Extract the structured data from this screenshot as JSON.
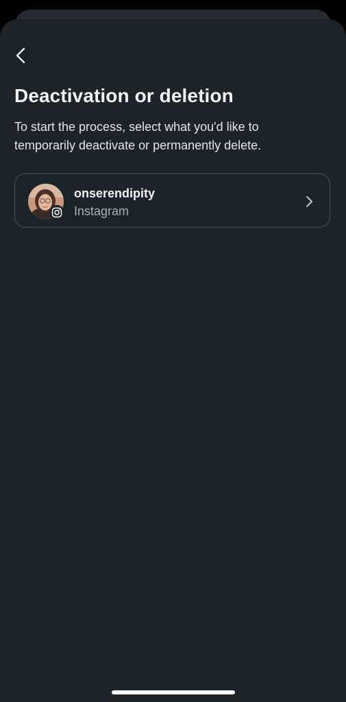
{
  "header": {
    "back_icon": "chevron-left-icon",
    "title": "Deactivation or deletion",
    "subtitle": "To start the process, select what you'd like to temporarily deactivate or permanently delete."
  },
  "accounts": [
    {
      "username": "onserendipity",
      "platform": "Instagram",
      "avatar_icon": "profile-photo",
      "badge_icon": "instagram-icon",
      "chevron_icon": "chevron-right-icon"
    }
  ],
  "colors": {
    "background": "#1c2329",
    "text_primary": "#f1f3f5",
    "text_secondary": "#a8b0b8",
    "card_border": "#4b5560"
  }
}
